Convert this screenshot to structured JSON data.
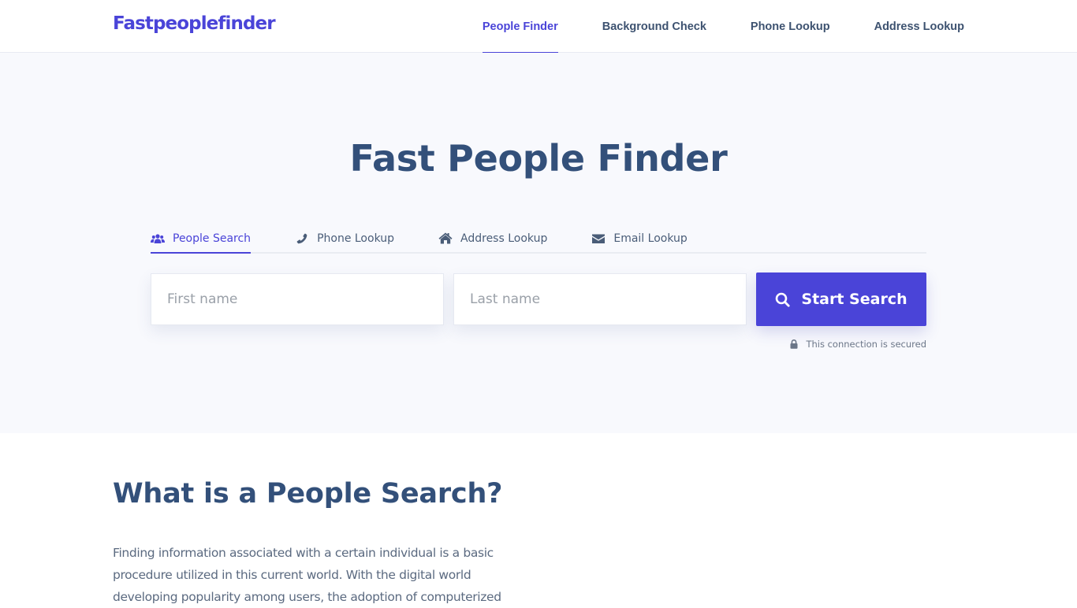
{
  "header": {
    "logo": "Fastpeoplefinder",
    "nav": [
      {
        "label": "People Finder",
        "active": true
      },
      {
        "label": "Background Check",
        "active": false
      },
      {
        "label": "Phone Lookup",
        "active": false
      },
      {
        "label": "Address Lookup",
        "active": false
      }
    ]
  },
  "hero": {
    "title": "Fast People Finder",
    "tabs": [
      {
        "label": "People Search",
        "icon": "users-icon",
        "active": true
      },
      {
        "label": "Phone Lookup",
        "icon": "phone-icon",
        "active": false
      },
      {
        "label": "Address Lookup",
        "icon": "home-icon",
        "active": false
      },
      {
        "label": "Email Lookup",
        "icon": "envelope-icon",
        "active": false
      }
    ],
    "form": {
      "first_name": {
        "value": "",
        "placeholder": "First name"
      },
      "last_name": {
        "value": "",
        "placeholder": "Last name"
      },
      "submit_label": "Start Search",
      "submit_icon": "search-icon"
    },
    "secured_text": "This connection is secured",
    "secured_icon": "lock-icon"
  },
  "content": {
    "title": "What is a People Search?",
    "paragraph_lines": [
      "Finding information associated with a certain individual is a basic",
      "procedure utilized in this current world. With the digital world",
      "developing popularity among users, the adoption of computerized"
    ]
  },
  "colors": {
    "brand": "#4a44d8",
    "heading": "#33507a",
    "hero_bg": "#f8f9fd",
    "body_text": "#5b6a80"
  }
}
